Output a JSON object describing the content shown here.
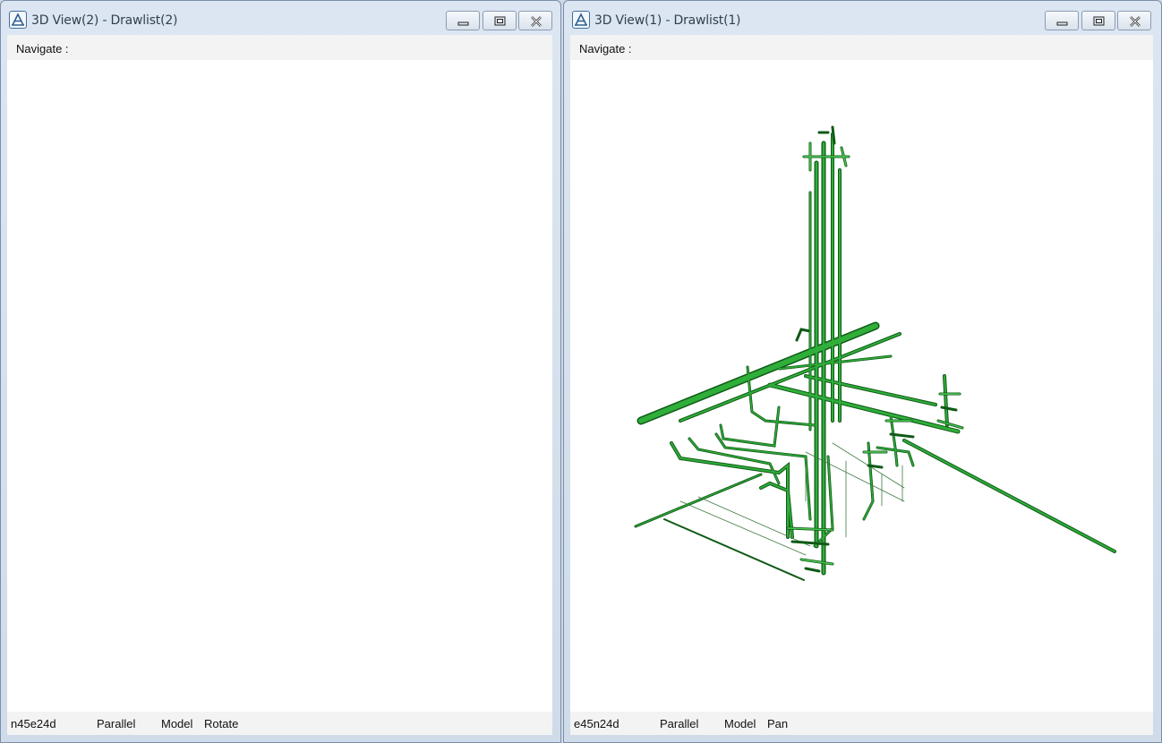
{
  "windows": [
    {
      "title": "3D View(2) - Drawlist(2)",
      "navigate_label": "Navigate :",
      "status": {
        "orientation": "n45e24d",
        "projection": "Parallel",
        "mode": "Model",
        "action": "Rotate"
      }
    },
    {
      "title": "3D View(1) - Drawlist(1)",
      "navigate_label": "Navigate :",
      "status": {
        "orientation": "e45n24d",
        "projection": "Parallel",
        "mode": "Model",
        "action": "Pan"
      }
    }
  ],
  "icons": {
    "app": "app-logo-icon",
    "minimize": "minimize-icon",
    "maximize": "maximize-icon",
    "close": "close-icon"
  },
  "colors": {
    "pipe": "#2fae3a",
    "pipe_dark": "#0f5a16",
    "viewport_bg": "#ffffff"
  }
}
